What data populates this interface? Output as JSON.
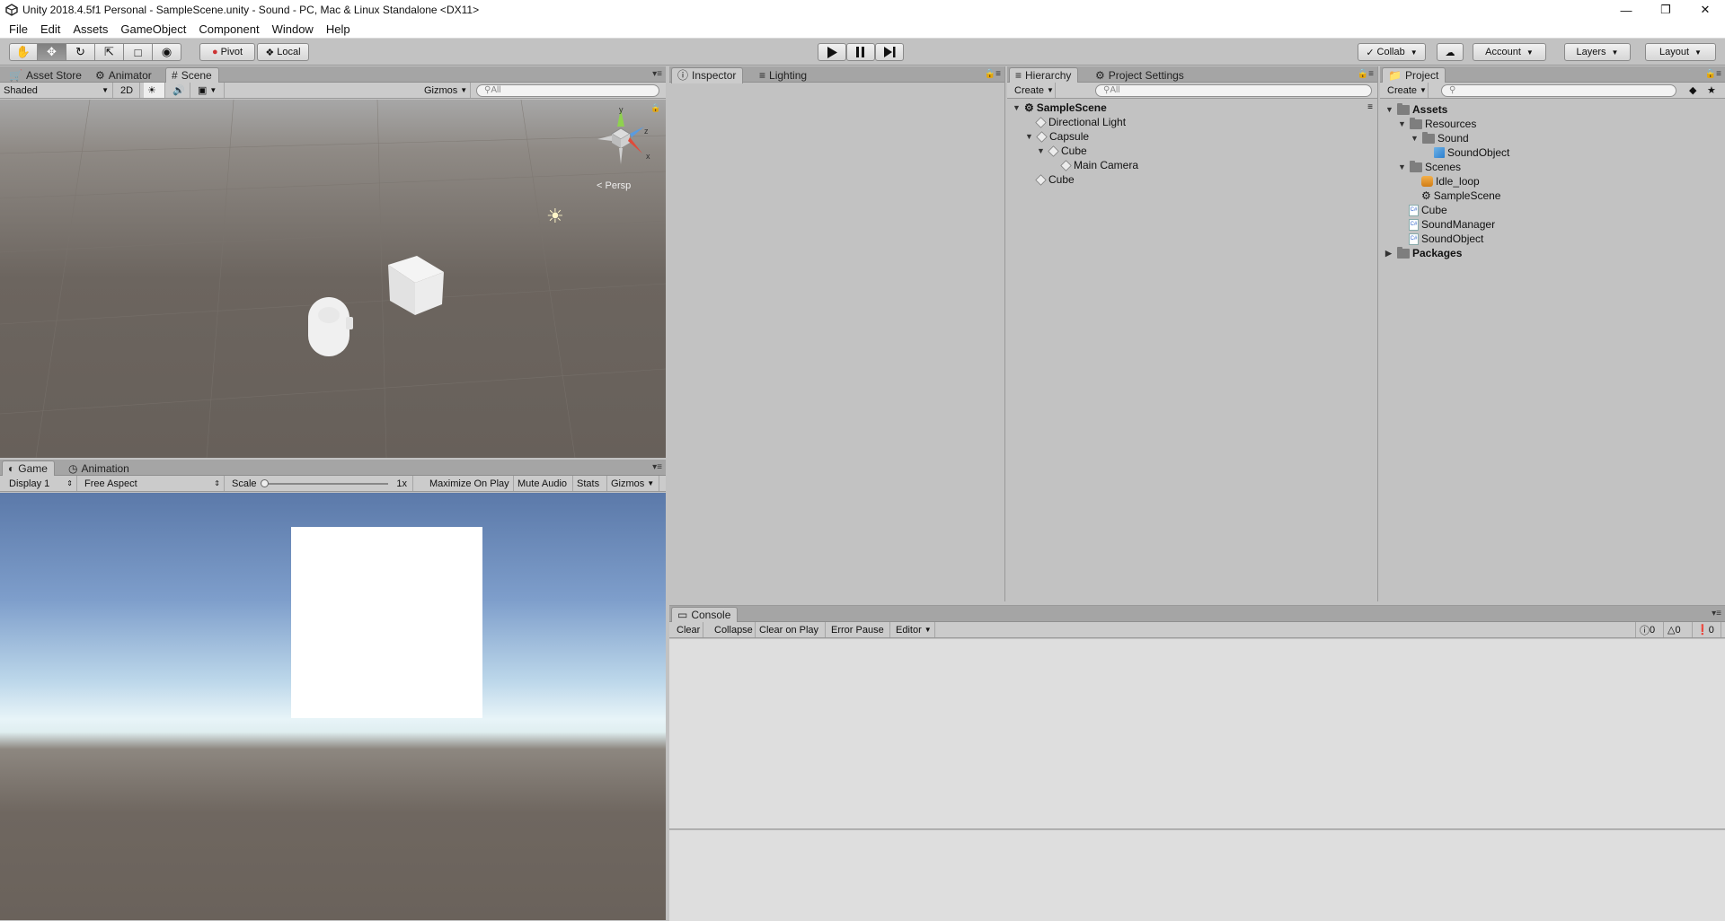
{
  "window": {
    "title": "Unity 2018.4.5f1 Personal - SampleScene.unity - Sound - PC, Mac & Linux Standalone <DX11>",
    "icons": [
      "unity-icon",
      "minimize-icon",
      "restore-icon",
      "close-icon"
    ]
  },
  "menu": [
    "File",
    "Edit",
    "Assets",
    "GameObject",
    "Component",
    "Window",
    "Help"
  ],
  "toolbar": {
    "pivot": "Pivot",
    "local": "Local",
    "collab": "Collab",
    "account": "Account",
    "layers": "Layers",
    "layout": "Layout"
  },
  "scene_panel": {
    "tabs": [
      "Asset Store",
      "Animator",
      "Scene"
    ],
    "shading": "Shaded",
    "mode2d": "2D",
    "gizmos": "Gizmos",
    "search_placeholder": "All",
    "persp": "Persp",
    "axes": [
      "y",
      "z",
      "x"
    ]
  },
  "game_panel": {
    "tabs": [
      "Game",
      "Animation"
    ],
    "display": "Display 1",
    "aspect": "Free Aspect",
    "scale_label": "Scale",
    "scale_value": "1x",
    "maximize": "Maximize On Play",
    "mute": "Mute Audio",
    "stats": "Stats",
    "gizmos": "Gizmos"
  },
  "inspector_panel": {
    "tabs": [
      "Inspector",
      "Lighting"
    ]
  },
  "hierarchy_panel": {
    "tabs": [
      "Hierarchy",
      "Project Settings"
    ],
    "create": "Create",
    "search_placeholder": "All",
    "scene": "SampleScene",
    "items": [
      "Directional Light",
      "Capsule",
      "Cube",
      "Main Camera",
      "Cube"
    ]
  },
  "project_panel": {
    "tab": "Project",
    "create": "Create",
    "items": [
      "Assets",
      "Resources",
      "Sound",
      "SoundObject",
      "Scenes",
      "Idle_loop",
      "SampleScene",
      "Cube",
      "SoundManager",
      "SoundObject",
      "Packages"
    ]
  },
  "console_panel": {
    "tab": "Console",
    "buttons": [
      "Clear",
      "Collapse",
      "Clear on Play",
      "Error Pause",
      "Editor"
    ],
    "counts": {
      "info": "0",
      "warn": "0",
      "error": "0"
    }
  }
}
